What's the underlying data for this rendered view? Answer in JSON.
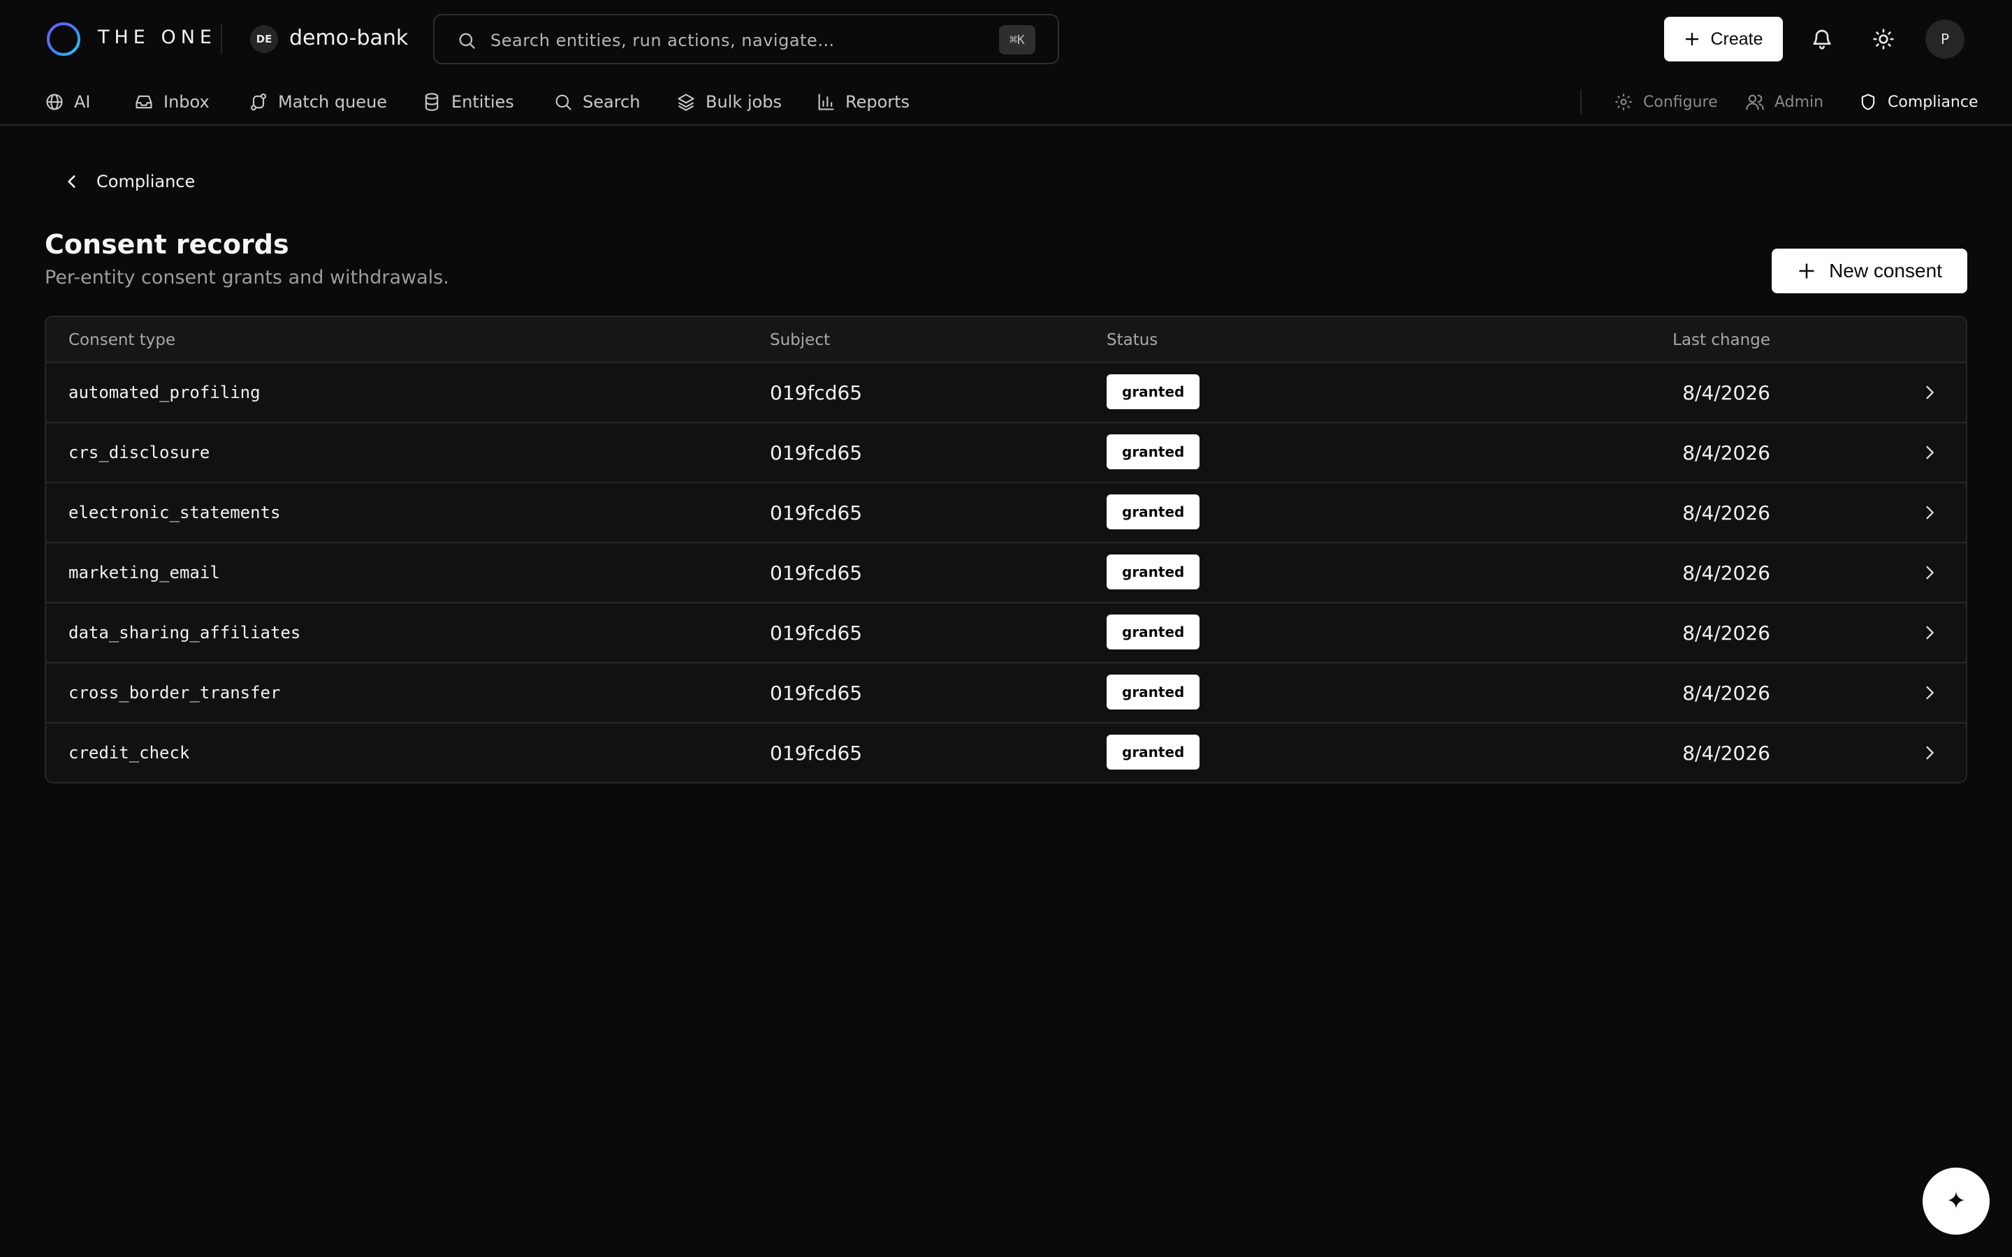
{
  "header": {
    "brand": "THE ONE",
    "workspace_badge": "DE",
    "workspace_name": "demo-bank",
    "search_placeholder": "Search entities, run actions, navigate…",
    "search_shortcut": "⌘K",
    "create_label": "Create",
    "avatar_initial": "P"
  },
  "nav": {
    "left": [
      {
        "label": "AI",
        "icon": "globe-icon"
      },
      {
        "label": "Inbox",
        "icon": "inbox-icon"
      },
      {
        "label": "Match queue",
        "icon": "route-icon"
      },
      {
        "label": "Entities",
        "icon": "database-icon"
      },
      {
        "label": "Search",
        "icon": "search-icon"
      },
      {
        "label": "Bulk jobs",
        "icon": "layers-icon"
      },
      {
        "label": "Reports",
        "icon": "bar-chart-icon"
      }
    ],
    "right": [
      {
        "label": "Configure",
        "icon": "gear-icon"
      },
      {
        "label": "Admin",
        "icon": "users-icon"
      },
      {
        "label": "Compliance",
        "icon": "shield-icon",
        "active": true
      }
    ]
  },
  "page": {
    "back_label": "Compliance",
    "title": "Consent records",
    "subtitle": "Per-entity consent grants and withdrawals.",
    "new_button_label": "New consent"
  },
  "table": {
    "columns": [
      "Consent type",
      "Subject",
      "Status",
      "Last change"
    ],
    "rows": [
      {
        "type": "automated_profiling",
        "subject": "019fcd65",
        "status": "granted",
        "last_change": "8/4/2026"
      },
      {
        "type": "crs_disclosure",
        "subject": "019fcd65",
        "status": "granted",
        "last_change": "8/4/2026"
      },
      {
        "type": "electronic_statements",
        "subject": "019fcd65",
        "status": "granted",
        "last_change": "8/4/2026"
      },
      {
        "type": "marketing_email",
        "subject": "019fcd65",
        "status": "granted",
        "last_change": "8/4/2026"
      },
      {
        "type": "data_sharing_affiliates",
        "subject": "019fcd65",
        "status": "granted",
        "last_change": "8/4/2026"
      },
      {
        "type": "cross_border_transfer",
        "subject": "019fcd65",
        "status": "granted",
        "last_change": "8/4/2026"
      },
      {
        "type": "credit_check",
        "subject": "019fcd65",
        "status": "granted",
        "last_change": "8/4/2026"
      }
    ]
  },
  "fab": {
    "icon": "sparkle-icon",
    "glyph": "✦"
  },
  "colors": {
    "background": "#0a0a0a",
    "surface": "#111111",
    "border": "#262626",
    "accent": "#ffffff"
  }
}
